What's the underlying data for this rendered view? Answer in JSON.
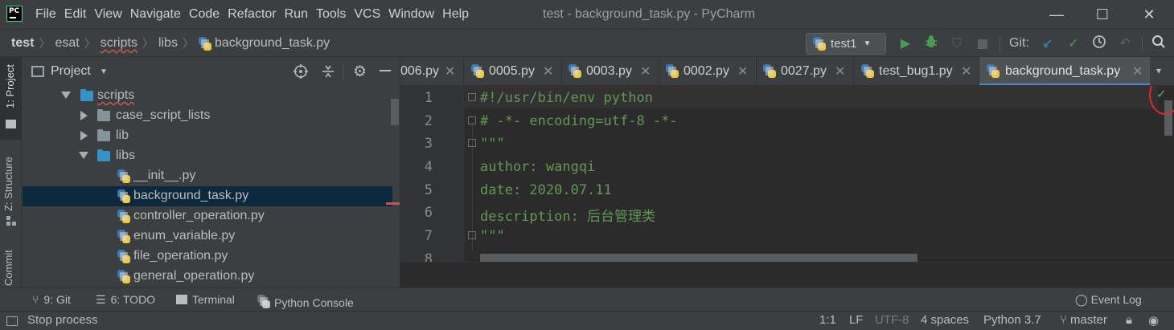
{
  "window": {
    "title": "test - background_task.py - PyCharm",
    "menu": [
      "File",
      "Edit",
      "View",
      "Navigate",
      "Code",
      "Refactor",
      "Run",
      "Tools",
      "VCS",
      "Window",
      "Help"
    ],
    "controls": {
      "minimize": "—",
      "maximize": "☐",
      "close": "✕"
    }
  },
  "breadcrumb": [
    "test",
    "esat",
    "scripts",
    "libs",
    "background_task.py"
  ],
  "toolbar": {
    "run_config": "test1",
    "git_label": "Git:"
  },
  "left_strip": [
    "1: Project",
    "Z: Structure",
    "Commit"
  ],
  "project_panel": {
    "title": "Project",
    "tree": [
      {
        "label": "scripts",
        "type": "folder",
        "state": "expanded"
      },
      {
        "label": "case_script_lists",
        "type": "folder",
        "state": "collapsed"
      },
      {
        "label": "lib",
        "type": "folder",
        "state": "collapsed"
      },
      {
        "label": "libs",
        "type": "folder",
        "state": "expanded"
      },
      {
        "label": "__init__.py",
        "type": "file"
      },
      {
        "label": "background_task.py",
        "type": "file",
        "selected": true
      },
      {
        "label": "controller_operation.py",
        "type": "file"
      },
      {
        "label": "enum_variable.py",
        "type": "file"
      },
      {
        "label": "file_operation.py",
        "type": "file"
      },
      {
        "label": "general_operation.py",
        "type": "file"
      }
    ]
  },
  "editor_tabs": [
    {
      "label": "006.py"
    },
    {
      "label": "0005.py"
    },
    {
      "label": "0003.py"
    },
    {
      "label": "0002.py"
    },
    {
      "label": "0027.py"
    },
    {
      "label": "test_bug1.py"
    },
    {
      "label": "background_task.py",
      "active": true
    }
  ],
  "editor": {
    "lines": [
      {
        "num": "1",
        "text": "#!/usr/bin/env python"
      },
      {
        "num": "2",
        "text": "# -*- encoding=utf-8 -*-"
      },
      {
        "num": "3",
        "text": "\"\"\""
      },
      {
        "num": "4",
        "text": "author: wangqi"
      },
      {
        "num": "5",
        "text": "date: 2020.07.11"
      },
      {
        "num": "6",
        "text": "description: 后台管理类"
      },
      {
        "num": "7",
        "text": "\"\"\""
      },
      {
        "num": "8",
        "text": ""
      }
    ]
  },
  "tool_windows": [
    {
      "label": "9: Git"
    },
    {
      "label": "6: TODO"
    },
    {
      "label": "Terminal"
    },
    {
      "label": "Python Console"
    },
    {
      "label": "Event Log"
    }
  ],
  "status": {
    "message": "Stop process",
    "position": "1:1",
    "line_sep": "LF",
    "encoding": "UTF-8",
    "indent": "4 spaces",
    "interpreter": "Python 3.7",
    "branch": "master"
  },
  "colors": {
    "accent": "#4a88c7",
    "selection": "#0d293e",
    "comment_green": "#629755",
    "run_green": "#499c54",
    "error_red": "#e0282e"
  }
}
